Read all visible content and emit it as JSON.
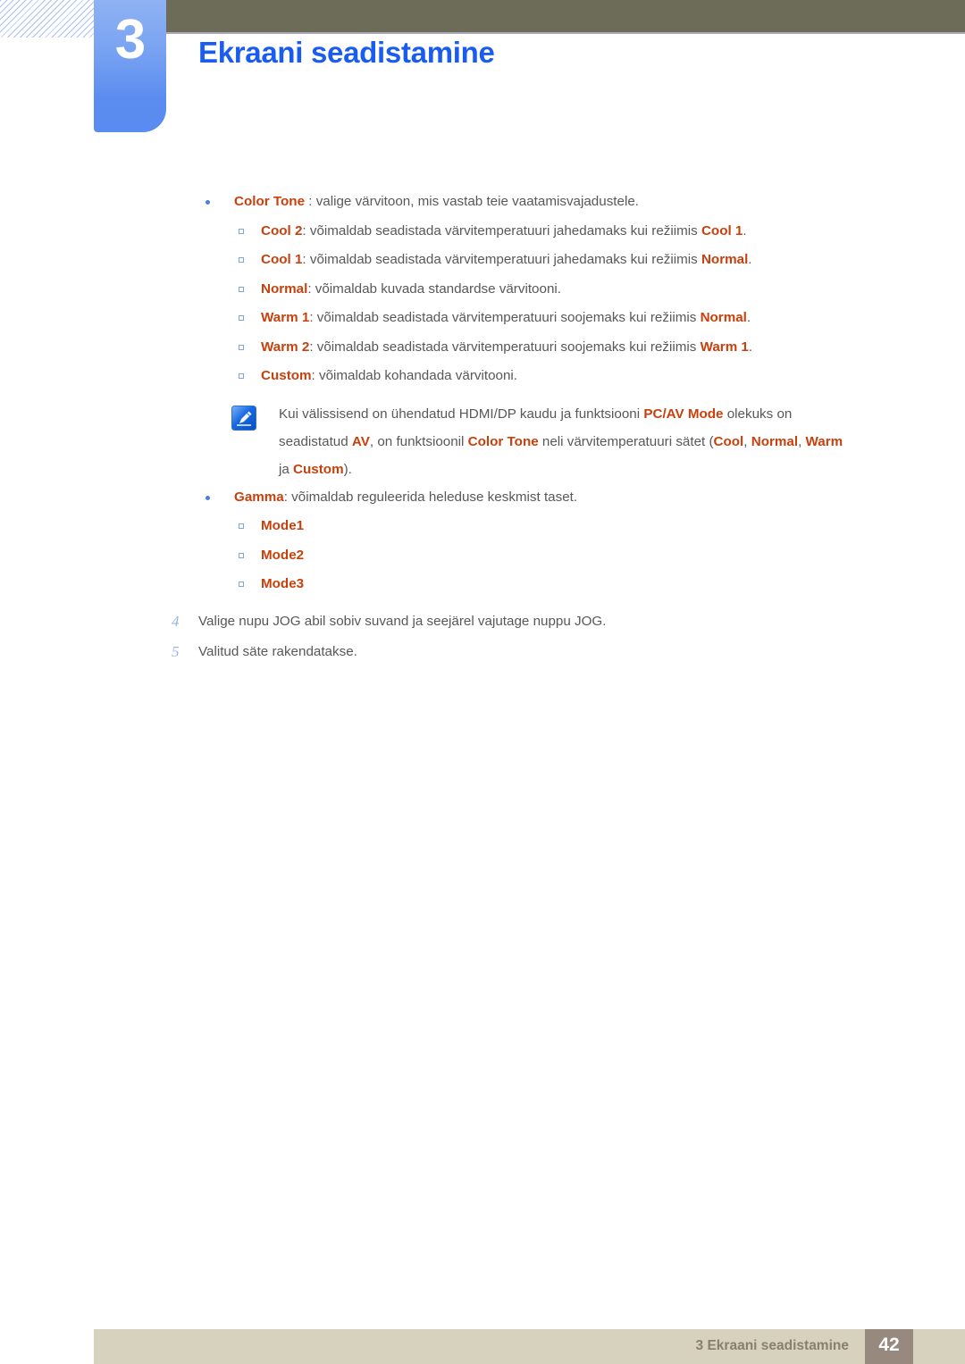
{
  "header": {
    "chapter_number": "3",
    "chapter_title": "Ekraani seadistamine"
  },
  "content": {
    "color_tone": {
      "label": "Color Tone",
      "desc": " : valige värvitoon, mis vastab teie vaatamisvajadustele.",
      "options": [
        {
          "name": "Cool 2",
          "mid": ": võimaldab seadistada värvitemperatuuri jahedamaks kui režiimis ",
          "ref": "Cool 1",
          "end": "."
        },
        {
          "name": "Cool 1",
          "mid": ": võimaldab seadistada värvitemperatuuri jahedamaks kui režiimis ",
          "ref": "Normal",
          "end": "."
        },
        {
          "name": "Normal",
          "mid": ": võimaldab kuvada standardse värvitooni.",
          "ref": "",
          "end": ""
        },
        {
          "name": "Warm 1",
          "mid": ": võimaldab seadistada värvitemperatuuri soojemaks kui režiimis ",
          "ref": "Normal",
          "end": "."
        },
        {
          "name": "Warm 2",
          "mid": ": võimaldab seadistada värvitemperatuuri soojemaks kui režiimis ",
          "ref": "Warm 1",
          "end": "."
        },
        {
          "name": "Custom",
          "mid": ": võimaldab kohandada värvitooni.",
          "ref": "",
          "end": ""
        }
      ]
    },
    "note": {
      "icon": "note-pencil-icon",
      "line1_a": "Kui välissisend on ühendatud HDMI/DP kaudu ja funktsiooni ",
      "line1_kw": "PC/AV Mode",
      "line1_b": " olekuks on",
      "line2_a": "seadistatud ",
      "line2_kw1": "AV",
      "line2_b": ", on funktsioonil ",
      "line2_kw2": "Color Tone",
      "line2_c": " neli värvitemperatuuri sätet (",
      "line2_kw3": "Cool",
      "line2_d": ", ",
      "line2_kw4": "Normal",
      "line2_e": ", ",
      "line2_kw5": "Warm",
      "line3_a": "ja ",
      "line3_kw": "Custom",
      "line3_b": ")."
    },
    "gamma": {
      "label": "Gamma",
      "desc": ": võimaldab reguleerida heleduse keskmist taset.",
      "modes": [
        "Mode1",
        "Mode2",
        "Mode3"
      ]
    },
    "steps": [
      {
        "num": "4",
        "text": "Valige nupu JOG abil sobiv suvand ja seejärel vajutage nuppu JOG."
      },
      {
        "num": "5",
        "text": "Valitud säte rakendatakse."
      }
    ]
  },
  "footer": {
    "text": "3 Ekraani seadistamine",
    "page_number": "42"
  },
  "colors": {
    "keyword_orange": "#c8400c",
    "title_blue": "#1a5cef",
    "topbar_olive": "#6d6c58",
    "footer_tan": "#d6d2bd",
    "page_badge": "#97897e"
  }
}
